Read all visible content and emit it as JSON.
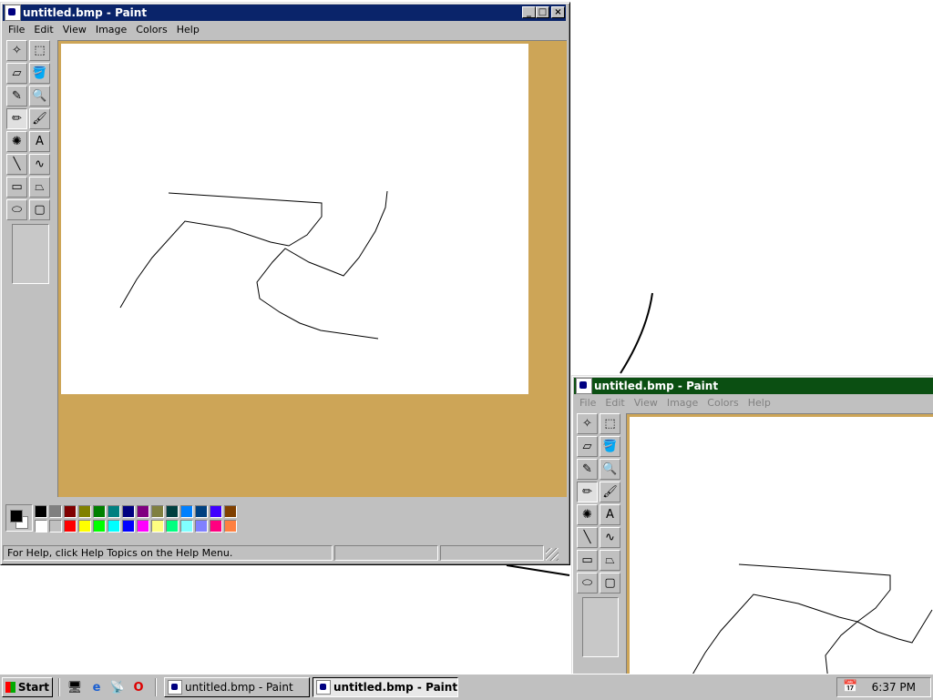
{
  "windows": [
    {
      "title": "untitled.bmp - Paint",
      "active": true,
      "menu": [
        "File",
        "Edit",
        "View",
        "Image",
        "Colors",
        "Help"
      ],
      "status": "For Help, click Help Topics on the Help Menu."
    },
    {
      "title": "untitled.bmp - Paint",
      "active": false,
      "menu": [
        "File",
        "Edit",
        "View",
        "Image",
        "Colors",
        "Help"
      ]
    }
  ],
  "tools": [
    {
      "name": "free-form-select-icon",
      "glyph": "✧"
    },
    {
      "name": "select-icon",
      "glyph": "⬚"
    },
    {
      "name": "eraser-icon",
      "glyph": "▱"
    },
    {
      "name": "fill-icon",
      "glyph": "🪣"
    },
    {
      "name": "pick-color-icon",
      "glyph": "✎"
    },
    {
      "name": "magnifier-icon",
      "glyph": "🔍"
    },
    {
      "name": "pencil-icon",
      "glyph": "✏"
    },
    {
      "name": "brush-icon",
      "glyph": "🖌"
    },
    {
      "name": "airbrush-icon",
      "glyph": "✺"
    },
    {
      "name": "text-icon",
      "glyph": "A"
    },
    {
      "name": "line-icon",
      "glyph": "╲"
    },
    {
      "name": "curve-icon",
      "glyph": "∿"
    },
    {
      "name": "rectangle-icon",
      "glyph": "▭"
    },
    {
      "name": "polygon-icon",
      "glyph": "⏢"
    },
    {
      "name": "ellipse-icon",
      "glyph": "⬭"
    },
    {
      "name": "rounded-rectangle-icon",
      "glyph": "▢"
    }
  ],
  "palette": {
    "foreground": "#000000",
    "background": "#ffffff",
    "row1": [
      "#000000",
      "#808080",
      "#800000",
      "#808000",
      "#008000",
      "#008080",
      "#000080",
      "#800080",
      "#808040",
      "#004040",
      "#0080ff",
      "#004080",
      "#4000ff",
      "#804000"
    ],
    "row2": [
      "#ffffff",
      "#c0c0c0",
      "#ff0000",
      "#ffff00",
      "#00ff00",
      "#00ffff",
      "#0000ff",
      "#ff00ff",
      "#ffff80",
      "#00ff80",
      "#80ffff",
      "#8080ff",
      "#ff0080",
      "#ff8040"
    ]
  },
  "taskbar": {
    "start_label": "Start",
    "quick_launch": [
      "desktop-icon",
      "ie-icon",
      "channels-icon",
      "opera-icon"
    ],
    "buttons": [
      {
        "label": "untitled.bmp - Paint",
        "active": false
      },
      {
        "label": "untitled.bmp - Paint",
        "active": true
      }
    ],
    "clock": "6:37 PM"
  },
  "colors": {
    "title_active": "#0a246a",
    "title_inactive": "#0b4f12",
    "workspace": "#cda557"
  }
}
